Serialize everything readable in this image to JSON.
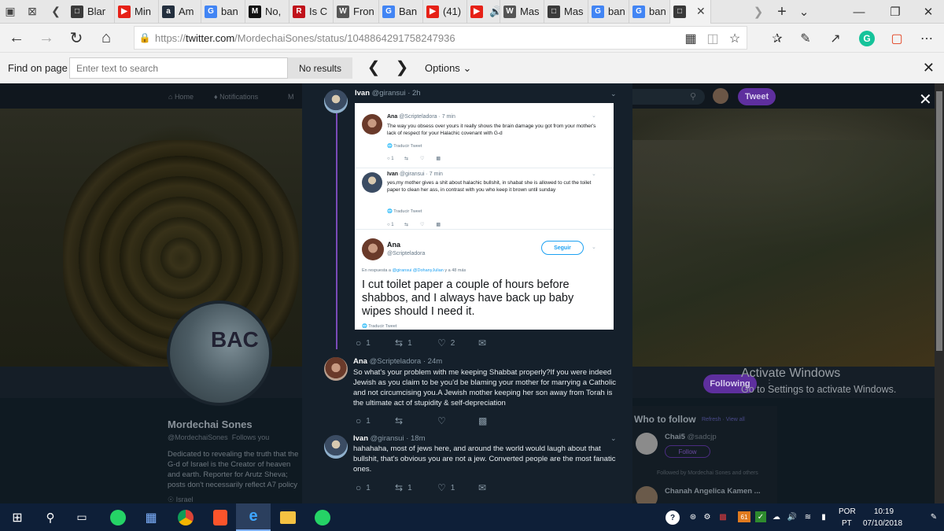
{
  "browser": {
    "tabs": [
      {
        "label": "Blar",
        "icon": "page-icon",
        "color": "#3a3a3a"
      },
      {
        "label": "Min",
        "icon": "youtube-icon",
        "color": "#e62117"
      },
      {
        "label": "Am",
        "icon": "amazon-icon",
        "color": "#232f3e"
      },
      {
        "label": "ban",
        "icon": "google-icon",
        "color": "#4285f4"
      },
      {
        "label": "No,",
        "icon": "medium-icon",
        "color": "#111111"
      },
      {
        "label": "Is C",
        "icon": "r-icon",
        "color": "#c0121b"
      },
      {
        "label": "Fron",
        "icon": "wikipedia-icon",
        "color": "#555555"
      },
      {
        "label": "Ban",
        "icon": "google-icon",
        "color": "#4285f4"
      },
      {
        "label": "(41)",
        "icon": "youtube-icon",
        "color": "#e62117"
      },
      {
        "label": "",
        "icon": "youtube-audio-icon",
        "color": "#e62117"
      },
      {
        "label": "Mas",
        "icon": "wikipedia-icon",
        "color": "#555555"
      },
      {
        "label": "Mas",
        "icon": "page-icon",
        "color": "#3a3a3a"
      },
      {
        "label": "ban",
        "icon": "google-icon",
        "color": "#4285f4"
      },
      {
        "label": "ban",
        "icon": "google-icon",
        "color": "#4285f4"
      },
      {
        "label": "",
        "icon": "page-icon",
        "color": "#3a3a3a",
        "active": true
      }
    ],
    "url": "https://twitter.com/MordechaiSones/status/1048864291758247936",
    "url_display_prefix": "https://",
    "url_display_host": "twitter.com",
    "url_display_path": "/MordechaiSones/status/1048864291758247936"
  },
  "find": {
    "label": "Find on page",
    "placeholder": "Enter text to search",
    "results": "No results",
    "options": "Options"
  },
  "twitter_nav": {
    "home": "Home",
    "notifications": "Notifications",
    "messages": "M",
    "tweet_button": "Tweet"
  },
  "profile": {
    "name": "Mordechai Sones",
    "handle": "@MordechaiSones",
    "follows_you": "Follows you",
    "bio": "Dedicated to revealing the truth that the G-d of Israel is the Creator of heaven and earth. Reporter for Arutz Sheva; posts don't necessarily reflect A7 policy",
    "location": "Israel",
    "following_button": "Following",
    "badge_text": "BAC"
  },
  "who_to_follow": {
    "title": "Who to follow",
    "refresh": "Refresh",
    "view_all": "View all",
    "user1_name": "Chai5",
    "user1_handle": "@sadcjp",
    "follow": "Follow",
    "followed_by": "Followed by Mordechai Sones and others",
    "user2_name": "Chanah Angelica Kamen ..."
  },
  "watermark": {
    "line1": "Activate Windows",
    "line2": "Go to Settings to activate Windows."
  },
  "thread": {
    "tweet1": {
      "name": "Ivan",
      "handle": "@giransui",
      "time": "· 2h",
      "reply": "1",
      "retweet": "1",
      "like": "2"
    },
    "embedded": {
      "t1_name": "Ana",
      "t1_meta": "@Scripteladora · 7 min",
      "t1_body": "The way you obsess over yours it really shows the brain damage you got from your mother's lack of respect for your Halachic covenant with G-d",
      "t1_translate": "Traducir Tweet",
      "t1_reply": "1",
      "t2_name": "Ivan",
      "t2_meta": "@giransui · 7 min",
      "t2_body": "yes,my mother gives a shit about halachic bullshit, in shabat she is allowed to cut the toilet paper to clean her ass, in contrast with you who keep it brown until sunday",
      "t2_translate": "Traducir Tweet",
      "t2_reply": "1",
      "t3_name": "Ana",
      "t3_handle": "@Scripteladora",
      "follow_label": "Seguir",
      "reply_to_prefix": "En respuesta a",
      "reply_to_users": "@giransui @DohanyJulian",
      "reply_to_suffix": "y a 48 más",
      "t3_body": "I cut toilet paper a couple of hours before shabbos, and I always have back up  baby wipes should I need it.",
      "t3_translate": "Traducir Tweet"
    },
    "tweet2": {
      "name": "Ana",
      "handle": "@Scripteladora",
      "time": "· 24m",
      "body": "So what's your problem with me keeping Shabbat properly?If you were indeed Jewish as you claim to be you'd be blaming your mother for marrying a Catholic and not circumcising you.A Jewish mother keeping her son away from Torah is the ultimate act of stupidity & self-depreciation",
      "reply": "1"
    },
    "tweet3": {
      "name": "Ivan",
      "handle": "@giransui",
      "time": "· 18m",
      "body": "hahahaha, most of jews here, and around the world would laugh about that bullshit, that's obvious you are not a jew. Converted people are the most fanatic ones.",
      "reply": "1",
      "retweet": "1",
      "like": "1"
    }
  },
  "taskbar": {
    "language": "POR",
    "region": "PT",
    "time": "10:19",
    "date": "07/10/2018",
    "badge_61": "61"
  }
}
